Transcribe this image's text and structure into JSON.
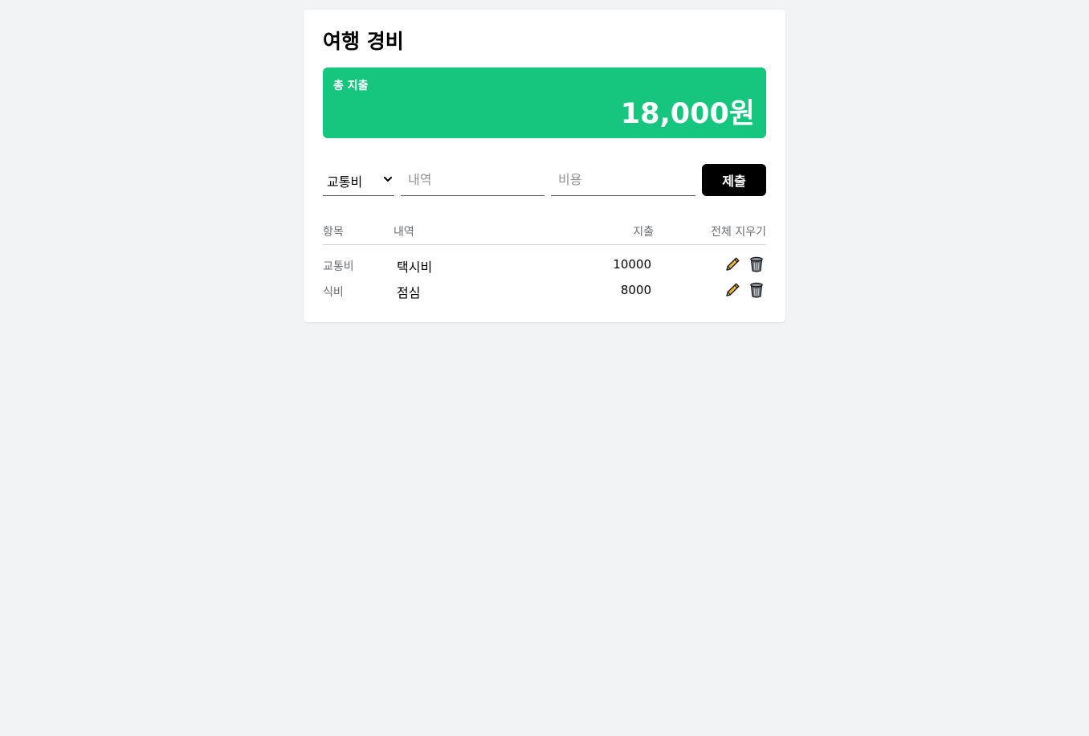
{
  "app": {
    "title": "여행 경비"
  },
  "summary": {
    "label": "총 지출",
    "amount": "18,000원"
  },
  "form": {
    "category_selected": "교통비",
    "description_placeholder": "내역",
    "cost_placeholder": "비용",
    "submit_label": "제출"
  },
  "table": {
    "headers": {
      "category": "항목",
      "description": "내역",
      "cost": "지출",
      "clear_all": "전체 지우기"
    },
    "rows": [
      {
        "category": "교통비",
        "description": "택시비",
        "cost": "10000"
      },
      {
        "category": "식비",
        "description": "점심",
        "cost": "8000"
      }
    ]
  },
  "icons": {
    "edit": "pencil-icon",
    "delete": "trash-icon",
    "select": "chevron-down-icon"
  },
  "colors": {
    "accent": "#16c67f",
    "button": "#000000",
    "pencil": "#f2b632",
    "trash": "#6b6f78"
  }
}
